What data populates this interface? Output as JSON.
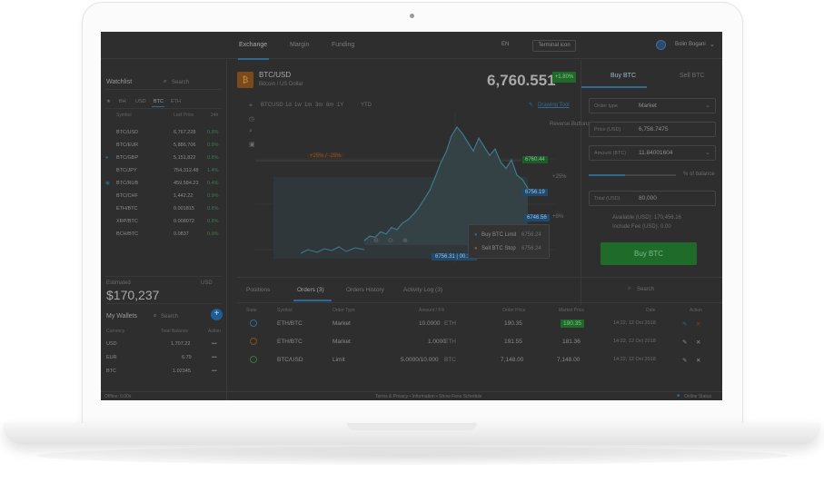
{
  "nav": {
    "tabs": [
      "Exchange",
      "Margin",
      "Funding"
    ],
    "lang": "EN",
    "terminal_button": "Terminal icon",
    "user_name": "Bolin Bogani"
  },
  "watchlist": {
    "title": "Watchlist",
    "search_placeholder": "Search",
    "tabs": [
      "★",
      "BH",
      "USD",
      "BTC",
      "ETH"
    ],
    "columns": [
      "Symbol",
      "Last Price",
      "24h"
    ],
    "rows": [
      {
        "symbol": "BTC/USD",
        "price": "6,767,228",
        "change": "0.8%"
      },
      {
        "symbol": "BTC/EUR",
        "price": "5,886,706",
        "change": "0.8%"
      },
      {
        "symbol": "BTC/GBP",
        "price": "5,151,822",
        "change": "0.8%"
      },
      {
        "symbol": "BTC/JPY",
        "price": "754,312.48",
        "change": "1.4%"
      },
      {
        "symbol": "BTC/RUB",
        "price": "459,584.23",
        "change": "0.4%"
      },
      {
        "symbol": "BTC/CHF",
        "price": "1,442.22",
        "change": "0.9%"
      },
      {
        "symbol": "ETH/BTC",
        "price": "0.001815",
        "change": "0.8%"
      },
      {
        "symbol": "XRP/BTC",
        "price": "0.008072",
        "change": "0.8%"
      },
      {
        "symbol": "BCH/BTC",
        "price": "0.0837",
        "change": "0.9%"
      }
    ]
  },
  "balance": {
    "label": "Estimated",
    "value": "$170,237",
    "currency": "USD"
  },
  "wallets": {
    "title": "My Wallets",
    "search_placeholder": "Search",
    "add": "+",
    "columns": [
      "Currency",
      "Total Balance",
      "Action"
    ],
    "rows": [
      {
        "currency": "USD",
        "balance": "1,707.22",
        "action": "•••"
      },
      {
        "currency": "EUR",
        "balance": "6.79",
        "action": "•••"
      },
      {
        "currency": "BTC",
        "balance": "1.02345",
        "action": "•••"
      }
    ]
  },
  "pair": {
    "icon": "₿",
    "name": "BTC/USD",
    "subtitle": "Bitcoin / US Dollar",
    "price": "6,760.551",
    "change": "+1.80%"
  },
  "chart_toolbar": {
    "items": [
      "BTCUSD",
      "1d",
      "1w",
      "1m",
      "3m",
      "6m",
      "1Y",
      "YTD"
    ],
    "drawing_link": "Drawing Tool",
    "reverse_label": "Reverse Buttons"
  },
  "chart_labels": {
    "tag_a": "6760.44",
    "tag_b": "6756.19",
    "tag_c": "6746.56",
    "cross": "6756.31 | 00.14",
    "marker_pct": "+25% / -25%",
    "right_a": "+25%",
    "right_b": "+8%"
  },
  "chart_data": {
    "type": "line",
    "x": [],
    "values": [
      14,
      18,
      17,
      22,
      20,
      26,
      24,
      30,
      33,
      38,
      44,
      52,
      60,
      72,
      85,
      95,
      110,
      118,
      112,
      104,
      96,
      108,
      100,
      92,
      98,
      86,
      80,
      88,
      74,
      70,
      62
    ],
    "grid": true
  },
  "chart_popup": {
    "items": [
      {
        "label": "Buy BTC Limit",
        "value": "6756.24"
      },
      {
        "label": "Sell BTC Stop",
        "value": "6756.24"
      }
    ]
  },
  "trade": {
    "buy_tab": "Buy BTC",
    "sell_tab": "Sell BTC",
    "fields": [
      {
        "label": "Order type",
        "value": "Market"
      },
      {
        "label": "Price (USD)",
        "value": "6,756.7475"
      },
      {
        "label": "Amount (BTC)",
        "value": "11.84001604"
      },
      {
        "label": "Total (USD)",
        "value": "80,000"
      }
    ],
    "slider_label": "% of balance",
    "available": "Available (USD): 170,456.16",
    "fee": "Include Fee (USD): 0.00",
    "buy_button": "Buy BTC"
  },
  "orders": {
    "tabs": [
      "Positions",
      "Orders (3)",
      "Orders History",
      "Activity Log (3)"
    ],
    "search_placeholder": "Search",
    "columns": [
      "State",
      "Symbol",
      "Order Type",
      "Amount / Fill",
      "Order Price",
      "Market Price",
      "Date",
      "Action"
    ],
    "rows": [
      {
        "symbol": "ETH/BTC",
        "type": "Market",
        "amount": "10.0000",
        "amount_unit": "ETH",
        "order_price": "190.35",
        "market_price": "190.35",
        "date": "14:22, 12 Oct 2018"
      },
      {
        "symbol": "ETH/BTC",
        "type": "Market",
        "amount": "1.0000",
        "amount_unit": "ETH",
        "order_price": "191.55",
        "market_price": "181.36",
        "date": "14:22, 12 Oct 2018"
      },
      {
        "symbol": "BTC/USD",
        "type": "Limit",
        "amount": "5.0000/10.000",
        "amount_unit": "BTC",
        "order_price": "7,148.00",
        "market_price": "7,148.00",
        "date": "14:22, 12 Oct 2018"
      }
    ]
  },
  "footer": {
    "left": "Offline: 0.00s",
    "center": "Terms & Privacy   •   Information   •   Show Fees Schedule",
    "right": "Online Status"
  }
}
